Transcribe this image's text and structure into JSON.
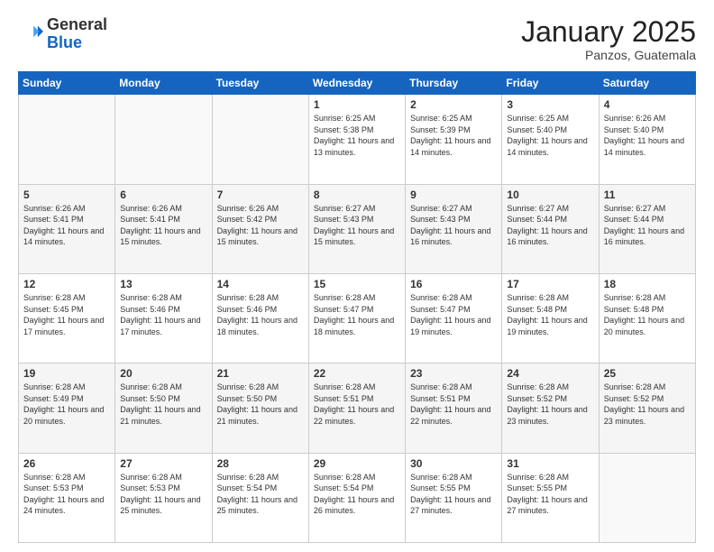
{
  "header": {
    "logo_general": "General",
    "logo_blue": "Blue",
    "month_title": "January 2025",
    "subtitle": "Panzos, Guatemala"
  },
  "weekdays": [
    "Sunday",
    "Monday",
    "Tuesday",
    "Wednesday",
    "Thursday",
    "Friday",
    "Saturday"
  ],
  "weeks": [
    [
      {
        "day": "",
        "info": ""
      },
      {
        "day": "",
        "info": ""
      },
      {
        "day": "",
        "info": ""
      },
      {
        "day": "1",
        "info": "Sunrise: 6:25 AM\nSunset: 5:38 PM\nDaylight: 11 hours\nand 13 minutes."
      },
      {
        "day": "2",
        "info": "Sunrise: 6:25 AM\nSunset: 5:39 PM\nDaylight: 11 hours\nand 14 minutes."
      },
      {
        "day": "3",
        "info": "Sunrise: 6:25 AM\nSunset: 5:40 PM\nDaylight: 11 hours\nand 14 minutes."
      },
      {
        "day": "4",
        "info": "Sunrise: 6:26 AM\nSunset: 5:40 PM\nDaylight: 11 hours\nand 14 minutes."
      }
    ],
    [
      {
        "day": "5",
        "info": "Sunrise: 6:26 AM\nSunset: 5:41 PM\nDaylight: 11 hours\nand 14 minutes."
      },
      {
        "day": "6",
        "info": "Sunrise: 6:26 AM\nSunset: 5:41 PM\nDaylight: 11 hours\nand 15 minutes."
      },
      {
        "day": "7",
        "info": "Sunrise: 6:26 AM\nSunset: 5:42 PM\nDaylight: 11 hours\nand 15 minutes."
      },
      {
        "day": "8",
        "info": "Sunrise: 6:27 AM\nSunset: 5:43 PM\nDaylight: 11 hours\nand 15 minutes."
      },
      {
        "day": "9",
        "info": "Sunrise: 6:27 AM\nSunset: 5:43 PM\nDaylight: 11 hours\nand 16 minutes."
      },
      {
        "day": "10",
        "info": "Sunrise: 6:27 AM\nSunset: 5:44 PM\nDaylight: 11 hours\nand 16 minutes."
      },
      {
        "day": "11",
        "info": "Sunrise: 6:27 AM\nSunset: 5:44 PM\nDaylight: 11 hours\nand 16 minutes."
      }
    ],
    [
      {
        "day": "12",
        "info": "Sunrise: 6:28 AM\nSunset: 5:45 PM\nDaylight: 11 hours\nand 17 minutes."
      },
      {
        "day": "13",
        "info": "Sunrise: 6:28 AM\nSunset: 5:46 PM\nDaylight: 11 hours\nand 17 minutes."
      },
      {
        "day": "14",
        "info": "Sunrise: 6:28 AM\nSunset: 5:46 PM\nDaylight: 11 hours\nand 18 minutes."
      },
      {
        "day": "15",
        "info": "Sunrise: 6:28 AM\nSunset: 5:47 PM\nDaylight: 11 hours\nand 18 minutes."
      },
      {
        "day": "16",
        "info": "Sunrise: 6:28 AM\nSunset: 5:47 PM\nDaylight: 11 hours\nand 19 minutes."
      },
      {
        "day": "17",
        "info": "Sunrise: 6:28 AM\nSunset: 5:48 PM\nDaylight: 11 hours\nand 19 minutes."
      },
      {
        "day": "18",
        "info": "Sunrise: 6:28 AM\nSunset: 5:48 PM\nDaylight: 11 hours\nand 20 minutes."
      }
    ],
    [
      {
        "day": "19",
        "info": "Sunrise: 6:28 AM\nSunset: 5:49 PM\nDaylight: 11 hours\nand 20 minutes."
      },
      {
        "day": "20",
        "info": "Sunrise: 6:28 AM\nSunset: 5:50 PM\nDaylight: 11 hours\nand 21 minutes."
      },
      {
        "day": "21",
        "info": "Sunrise: 6:28 AM\nSunset: 5:50 PM\nDaylight: 11 hours\nand 21 minutes."
      },
      {
        "day": "22",
        "info": "Sunrise: 6:28 AM\nSunset: 5:51 PM\nDaylight: 11 hours\nand 22 minutes."
      },
      {
        "day": "23",
        "info": "Sunrise: 6:28 AM\nSunset: 5:51 PM\nDaylight: 11 hours\nand 22 minutes."
      },
      {
        "day": "24",
        "info": "Sunrise: 6:28 AM\nSunset: 5:52 PM\nDaylight: 11 hours\nand 23 minutes."
      },
      {
        "day": "25",
        "info": "Sunrise: 6:28 AM\nSunset: 5:52 PM\nDaylight: 11 hours\nand 23 minutes."
      }
    ],
    [
      {
        "day": "26",
        "info": "Sunrise: 6:28 AM\nSunset: 5:53 PM\nDaylight: 11 hours\nand 24 minutes."
      },
      {
        "day": "27",
        "info": "Sunrise: 6:28 AM\nSunset: 5:53 PM\nDaylight: 11 hours\nand 25 minutes."
      },
      {
        "day": "28",
        "info": "Sunrise: 6:28 AM\nSunset: 5:54 PM\nDaylight: 11 hours\nand 25 minutes."
      },
      {
        "day": "29",
        "info": "Sunrise: 6:28 AM\nSunset: 5:54 PM\nDaylight: 11 hours\nand 26 minutes."
      },
      {
        "day": "30",
        "info": "Sunrise: 6:28 AM\nSunset: 5:55 PM\nDaylight: 11 hours\nand 27 minutes."
      },
      {
        "day": "31",
        "info": "Sunrise: 6:28 AM\nSunset: 5:55 PM\nDaylight: 11 hours\nand 27 minutes."
      },
      {
        "day": "",
        "info": ""
      }
    ]
  ]
}
